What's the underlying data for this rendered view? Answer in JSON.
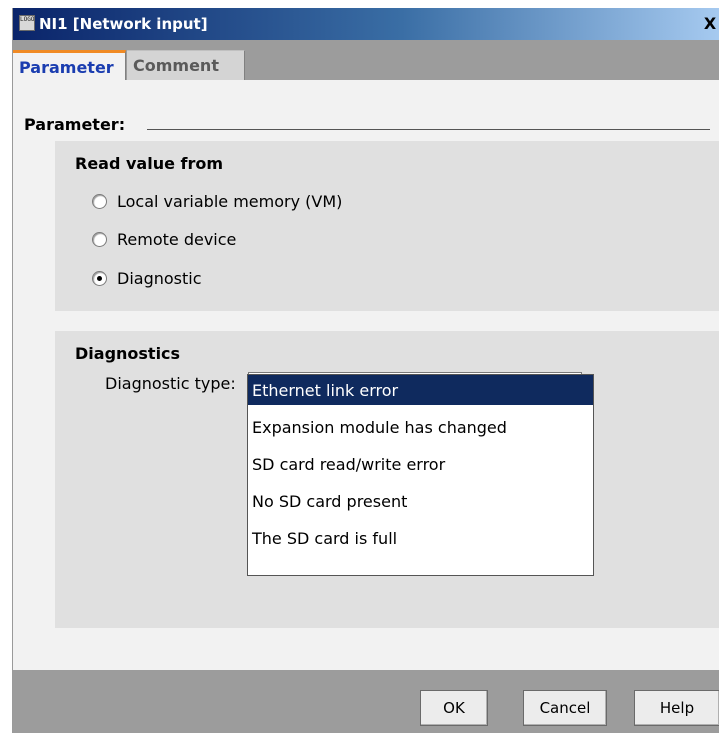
{
  "window": {
    "title": "NI1 [Network input]",
    "app_icon_text": "LOGO",
    "close_glyph": "X"
  },
  "tabs": [
    {
      "label": "Parameter",
      "active": true
    },
    {
      "label": "Comment",
      "active": false
    }
  ],
  "parameter": {
    "heading": "Parameter:",
    "read_value_from": {
      "title": "Read value from",
      "options": [
        {
          "label": "Local variable memory (VM)",
          "checked": false
        },
        {
          "label": "Remote device",
          "checked": false
        },
        {
          "label": "Diagnostic",
          "checked": true
        }
      ]
    },
    "diagnostics": {
      "title": "Diagnostics",
      "type_label": "Diagnostic type:",
      "type_value": "",
      "dropdown_options": [
        "Ethernet link error",
        "Expansion module has changed",
        "SD card read/write error",
        "No SD card present",
        "The SD card is full"
      ],
      "highlighted_index": 0
    }
  },
  "buttons": {
    "ok": "OK",
    "cancel": "Cancel",
    "help": "Help"
  },
  "colors": {
    "tab_active_text": "#1a3db0",
    "tab_accent": "#f08a24",
    "selection_bg": "#0f2a5e"
  }
}
